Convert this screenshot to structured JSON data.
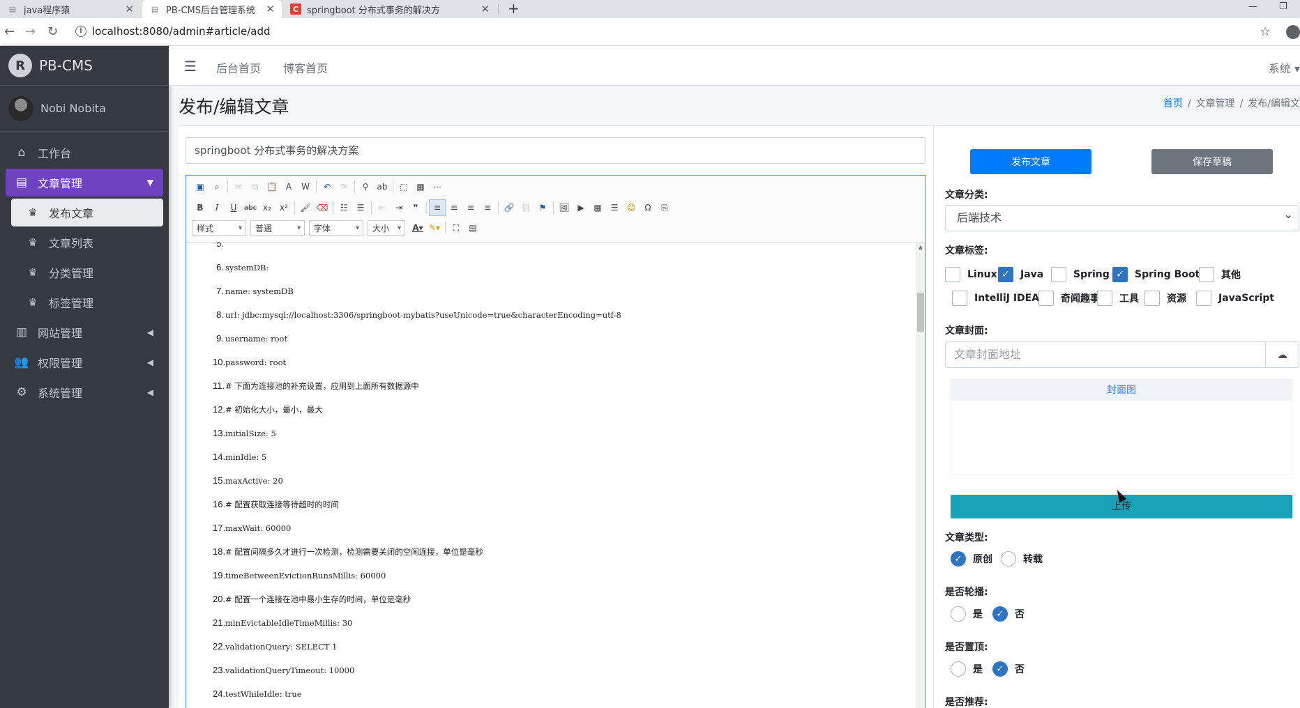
{
  "browser": {
    "tabs": [
      {
        "title": "java程序猿",
        "active": false
      },
      {
        "title": "PB-CMS后台管理系统",
        "active": true
      },
      {
        "title": "springboot 分布式事务的解决方",
        "active": false
      }
    ],
    "url": "localhost:8080/admin#article/add"
  },
  "sidebar": {
    "brand": "PB-CMS",
    "user_name": "Nobi Nobita",
    "menu": [
      {
        "label": "工作台",
        "icon": "home-icon"
      },
      {
        "label": "文章管理",
        "icon": "list-alt-icon",
        "open": true
      },
      {
        "label": "网站管理",
        "icon": "columns-icon"
      },
      {
        "label": "权限管理",
        "icon": "users-icon"
      },
      {
        "label": "系统管理",
        "icon": "cog-icon"
      }
    ],
    "submenu": [
      {
        "label": "发布文章",
        "active": true
      },
      {
        "label": "文章列表"
      },
      {
        "label": "分类管理"
      },
      {
        "label": "标签管理"
      }
    ]
  },
  "topnav": {
    "links": [
      "后台首页",
      "博客首页"
    ],
    "system": "系统"
  },
  "header": {
    "title": "发布/编辑文章",
    "breadcrumb": [
      "首页",
      "文章管理",
      "发布/编辑文"
    ]
  },
  "editor": {
    "title_value": "springboot 分布式事务的解决方案",
    "combos": [
      "样式",
      "普通",
      "字体",
      "大小"
    ],
    "lines": [
      {
        "num": "5.",
        "text": ""
      },
      {
        "num": "6.",
        "text": "systemDB:"
      },
      {
        "num": "7.",
        "text": "name: systemDB"
      },
      {
        "num": "8.",
        "text": "url: jdbc:mysql://localhost:3306/springboot-mybatis?useUnicode=true&characterEncoding=utf-8"
      },
      {
        "num": "9.",
        "text": "username: root"
      },
      {
        "num": "10.",
        "text": "password: root"
      },
      {
        "num": "11.",
        "text": "# 下面为连接池的补充设置，应用到上面所有数据源中"
      },
      {
        "num": "12.",
        "text": "# 初始化大小，最小，最大"
      },
      {
        "num": "13.",
        "text": "initialSize: 5"
      },
      {
        "num": "14.",
        "text": "minIdle: 5"
      },
      {
        "num": "15.",
        "text": "maxActive: 20"
      },
      {
        "num": "16.",
        "text": "# 配置获取连接等待超时的时间"
      },
      {
        "num": "17.",
        "text": "maxWait: 60000"
      },
      {
        "num": "18.",
        "text": "# 配置间隔多久才进行一次检测，检测需要关闭的空闲连接，单位是毫秒"
      },
      {
        "num": "19.",
        "text": "timeBetweenEvictionRunsMillis: 60000"
      },
      {
        "num": "20.",
        "text": "# 配置一个连接在池中最小生存的时间，单位是毫秒"
      },
      {
        "num": "21.",
        "text": "minEvictableIdleTimeMillis: 30"
      },
      {
        "num": "22.",
        "text": "validationQuery: SELECT 1"
      },
      {
        "num": "23.",
        "text": "validationQueryTimeout: 10000"
      },
      {
        "num": "24.",
        "text": "testWhileIdle: true"
      }
    ]
  },
  "form": {
    "publish_label": "发布文章",
    "draft_label": "保存草稿",
    "category_label": "文章分类:",
    "category_value": "后端技术",
    "tags_label": "文章标签:",
    "tags": [
      {
        "label": "Linux",
        "checked": false
      },
      {
        "label": "Java",
        "checked": true
      },
      {
        "label": "Spring",
        "checked": false
      },
      {
        "label": "Spring Boot",
        "checked": true
      },
      {
        "label": "其他",
        "checked": false
      },
      {
        "label": "IntelliJ IDEA",
        "checked": false
      },
      {
        "label": "奇闻趣事",
        "checked": false
      },
      {
        "label": "工具",
        "checked": false
      },
      {
        "label": "资源",
        "checked": false
      },
      {
        "label": "JavaScript",
        "checked": false
      }
    ],
    "cover_label": "文章封面:",
    "cover_placeholder": "文章封面地址",
    "cover_title": "封面图",
    "upload_label": "上传",
    "type_label": "文章类型:",
    "type_options": [
      "原创",
      "转载"
    ],
    "type_selected": "原创",
    "carousel_label": "是否轮播:",
    "top_label": "是否置顶:",
    "yes": "是",
    "no": "否",
    "carousel_selected": "否",
    "top_selected": "否",
    "recommend_label": "是否推荐:"
  },
  "colors": {
    "sidebar_bg": "#343a40",
    "menu_open": "#6f42c1",
    "primary": "#007bff",
    "secondary": "#6c757d",
    "info": "#17a2b8",
    "check": "#2f74c0"
  }
}
